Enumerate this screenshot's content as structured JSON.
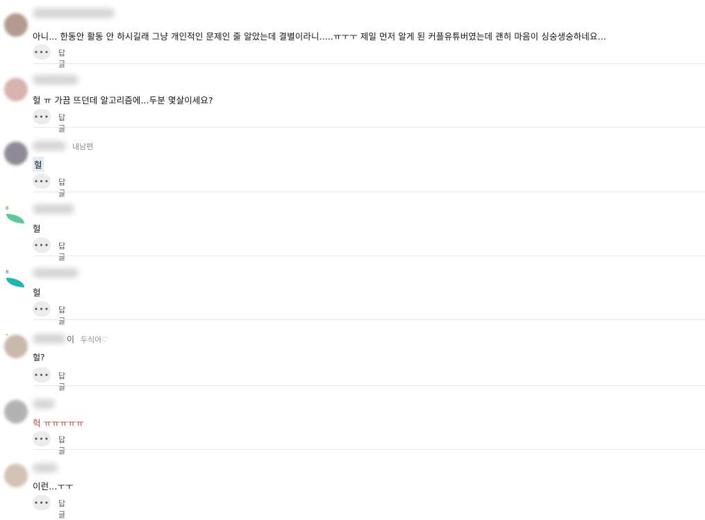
{
  "comments": [
    {
      "text": "아니... 한동안 활동 안 하시길래 그냥 개인적인 문제인 줄 알았는데 결별이라니.....ㅠㅜㅜ 제일 먼저 알게 된 커플유튜버였는데 괜히 마음이 싱숭생숭하네요...",
      "tag": "",
      "reply_label": "답글",
      "avatar_color": "#b49a8c"
    },
    {
      "text": "헐 ㅠ 가끔 뜨던데 알고리즘에...두분 몇살이세요?",
      "tag": "",
      "reply_label": "답글",
      "avatar_color": "#d9b3ae"
    },
    {
      "text": "헐",
      "tag": "내남편",
      "reply_label": "답글",
      "avatar_color": "#8f8a95"
    },
    {
      "text": "헐",
      "tag": "",
      "reply_label": "답글",
      "avatar_color": "#5fc79a",
      "avatar_mark": "8"
    },
    {
      "text": "헐",
      "tag": "",
      "reply_label": "답글",
      "avatar_color": "#1fb8b0",
      "avatar_mark": "8"
    },
    {
      "text": "헐?",
      "tag": "두식아♡",
      "nickname_tail": "이",
      "reply_label": "답글",
      "avatar_color": "#c9b8ad",
      "avatar_mark": "\""
    },
    {
      "text": "헉 ㅠㅠㅠㅠㅠ",
      "tag": "",
      "reply_label": "답글",
      "avatar_color": "#b3b3b3"
    },
    {
      "text": "이런...ㅜㅜ",
      "tag": "",
      "reply_label": "답글",
      "avatar_color": "#d3c2b6"
    }
  ],
  "icons": {
    "more": "•••"
  }
}
